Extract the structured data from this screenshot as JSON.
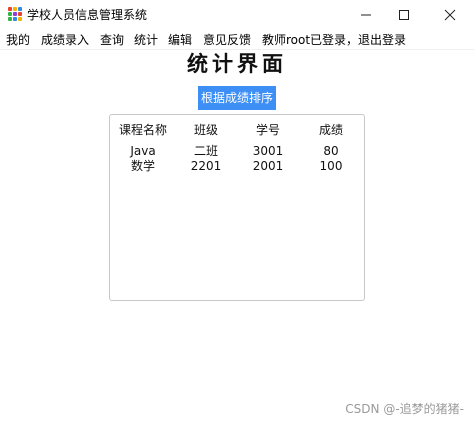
{
  "window": {
    "title": "学校人员信息管理系统",
    "icon_colors": [
      "#e8412c",
      "#f6b400",
      "#2f8ae5",
      "#35b34a",
      "#8c3fd6",
      "#e8412c",
      "#35b34a",
      "#2f8ae5",
      "#f6b400"
    ]
  },
  "menu": {
    "items": [
      "我的",
      "成绩录入",
      "查询",
      "统计",
      "编辑",
      "意见反馈",
      "教师root已登录，退出登录"
    ]
  },
  "page": {
    "heading": "统计界面",
    "sort_button_label": "根据成绩排序",
    "accent_color": "#3d8ff5"
  },
  "table": {
    "columns": [
      "课程名称",
      "班级",
      "学号",
      "成绩"
    ],
    "rows": [
      [
        "Java",
        "二班",
        "3001",
        "80"
      ],
      [
        "数学",
        "2201",
        "2001",
        "100"
      ]
    ]
  },
  "watermark": "CSDN @-追梦的猪猪-"
}
